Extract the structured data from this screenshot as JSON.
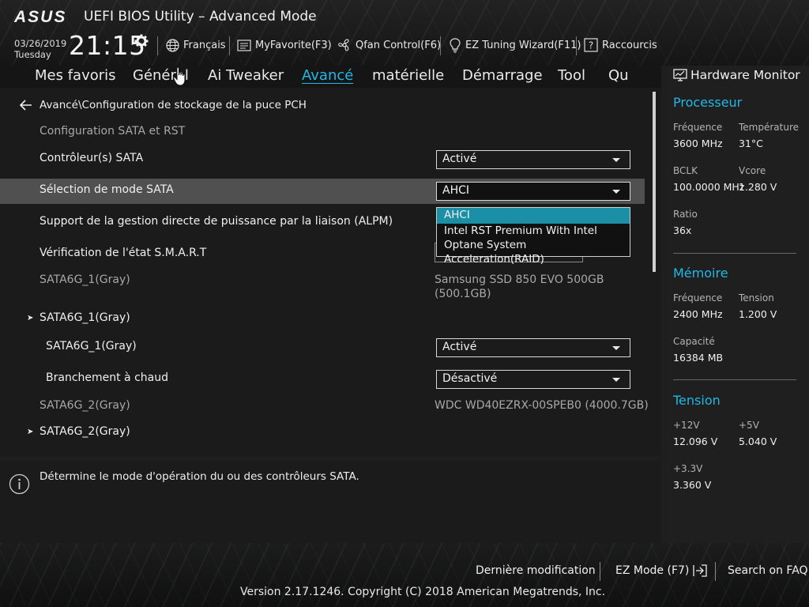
{
  "header": {
    "app_title": "UEFI BIOS Utility – Advanced Mode",
    "date": "03/26/2019",
    "day": "Tuesday",
    "time": "21:15",
    "language": "Français",
    "myfavorite": "MyFavorite(F3)",
    "qfan": "Qfan Control(F6)",
    "ez_tuning": "EZ Tuning Wizard(F11)",
    "shortcuts": "Raccourcis"
  },
  "tabs": [
    {
      "label": "Mes favoris"
    },
    {
      "label": "Général"
    },
    {
      "label": "Ai Tweaker"
    },
    {
      "label": "Avancé"
    },
    {
      "label": "matérielle"
    },
    {
      "label": "Démarrage"
    },
    {
      "label": "Tool"
    },
    {
      "label": "Qu"
    }
  ],
  "active_tab": "Avancé",
  "main": {
    "breadcrumb": "Avancé\\Configuration de stockage de la puce PCH",
    "section_title": "Configuration SATA et RST",
    "rows": {
      "sata_controller": {
        "label": "Contrôleur(s) SATA",
        "value": "Activé"
      },
      "sata_mode": {
        "label": "Sélection de mode SATA",
        "value": "AHCI"
      },
      "alpm": {
        "label": "Support de la gestion directe de puissance par la liaison (ALPM)"
      },
      "smart": {
        "label": "Vérification de l'état S.M.A.R.T"
      },
      "sata1_info": {
        "label": "SATA6G_1(Gray)",
        "value": "Samsung SSD 850 EVO 500GB (500.1GB)"
      },
      "sata1_group": {
        "label": "SATA6G_1(Gray)"
      },
      "sata1_port": {
        "label": "SATA6G_1(Gray)",
        "value": "Activé"
      },
      "hot_plug": {
        "label": "Branchement à chaud",
        "value": "Désactivé"
      },
      "sata2_info": {
        "label": "SATA6G_2(Gray)",
        "value": "WDC WD40EZRX-00SPEB0 (4000.7GB)"
      },
      "sata2_group": {
        "label": "SATA6G_2(Gray)"
      }
    },
    "dropdown_options": [
      "AHCI",
      "Intel RST Premium With Intel Optane System Acceleration(RAID)"
    ]
  },
  "help": {
    "text": "Détermine le mode d'opération du ou des contrôleurs SATA."
  },
  "hw_monitor": {
    "title": "Hardware Monitor",
    "cpu": {
      "title": "Processeur",
      "freq_label": "Fréquence",
      "freq_value": "3600 MHz",
      "temp_label": "Température",
      "temp_value": "31°C",
      "bclk_label": "BCLK",
      "bclk_value": "100.0000 MHz",
      "vcore_label": "Vcore",
      "vcore_value": "1.280 V",
      "ratio_label": "Ratio",
      "ratio_value": "36x"
    },
    "memory": {
      "title": "Mémoire",
      "freq_label": "Fréquence",
      "freq_value": "2400 MHz",
      "volt_label": "Tension",
      "volt_value": "1.200 V",
      "cap_label": "Capacité",
      "cap_value": "16384 MB"
    },
    "voltage": {
      "title": "Tension",
      "v12_label": "+12V",
      "v12_value": "12.096 V",
      "v5_label": "+5V",
      "v5_value": "5.040 V",
      "v33_label": "+3.3V",
      "v33_value": "3.360 V"
    }
  },
  "footer": {
    "last_modified": "Dernière modification",
    "ez_mode": "EZ Mode (F7)",
    "search_faq": "Search on FAQ",
    "version": "Version 2.17.1246. Copyright (C) 2018 American Megatrends, Inc."
  },
  "colors": {
    "accent": "#21b7e6",
    "dropdown_selected": "#1b8fa5",
    "highlight_row": "#505050"
  }
}
